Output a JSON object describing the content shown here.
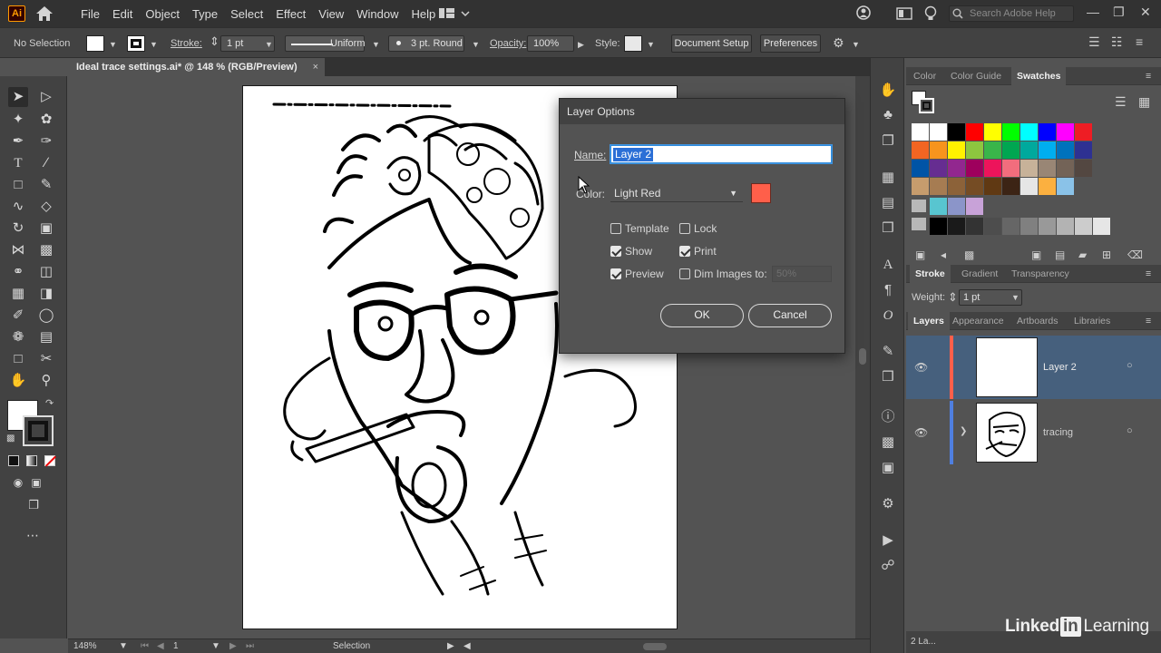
{
  "app": {
    "logo": "Ai"
  },
  "menu": [
    "File",
    "Edit",
    "Object",
    "Type",
    "Select",
    "Effect",
    "View",
    "Window",
    "Help"
  ],
  "search": {
    "placeholder": "Search Adobe Help"
  },
  "control_bar": {
    "selection": "No Selection",
    "stroke_label": "Stroke:",
    "stroke_weight": "1 pt",
    "profile": "Uniform",
    "brush": "3 pt. Round",
    "opacity_label": "Opacity:",
    "opacity": "100%",
    "style_label": "Style:",
    "document_setup": "Document Setup",
    "preferences": "Preferences"
  },
  "document_tab": {
    "title": "Ideal trace settings.ai* @ 148 % (RGB/Preview)",
    "close": "×"
  },
  "status_bar": {
    "zoom": "148%",
    "artboard": "1",
    "tool": "Selection"
  },
  "dialog": {
    "title": "Layer Options",
    "name_label": "Name:",
    "name_value": "Layer 2",
    "color_label": "Color:",
    "color_value": "Light Red",
    "color_hex": "#ff5f4a",
    "checkboxes": {
      "template": {
        "label": "Template",
        "checked": false
      },
      "lock": {
        "label": "Lock",
        "checked": false
      },
      "show": {
        "label": "Show",
        "checked": true
      },
      "print": {
        "label": "Print",
        "checked": true
      },
      "preview": {
        "label": "Preview",
        "checked": true
      },
      "dim": {
        "label": "Dim Images to:",
        "checked": false,
        "value": "50%"
      }
    },
    "ok": "OK",
    "cancel": "Cancel"
  },
  "swatches_panel": {
    "tabs": [
      "Color",
      "Color Guide",
      "Swatches"
    ],
    "active_tab": "Swatches",
    "row1": [
      "#ffffff",
      "#ffffff",
      "#000000",
      "#ff0000",
      "#ffff00",
      "#00ff00",
      "#00ffff",
      "#0000ff",
      "#ff00ff",
      "#ee1d24"
    ],
    "row2": [
      "#f26522",
      "#f7941d",
      "#fff200",
      "#8dc63f",
      "#39b54a",
      "#00a651",
      "#00a99d",
      "#00aeef",
      "#0072bc",
      "#2e3192"
    ],
    "row3": [
      "#0054a6",
      "#662d91",
      "#92278f",
      "#9e005d",
      "#ed145b",
      "#f26d7d",
      "#c7b299",
      "#998675",
      "#736357",
      "#534741"
    ],
    "row4": [
      "#c69c6d",
      "#a67c52",
      "#8c6239",
      "#754c24",
      "#603913",
      "#3c2415",
      "#e6e6e6",
      "#fbb040",
      "#8ac2e8"
    ],
    "row5": [
      "#58c5d0",
      "#8b95c9",
      "#c8a2d8"
    ],
    "row6": [
      "#000000",
      "#1a1a1a",
      "#333333",
      "#4d4d4d",
      "#666666",
      "#808080",
      "#999999",
      "#b3b3b3",
      "#cccccc",
      "#e6e6e6"
    ]
  },
  "stroke_panel": {
    "tabs": [
      "Stroke",
      "Gradient",
      "Transparency"
    ],
    "weight_label": "Weight:",
    "weight_value": "1 pt"
  },
  "layers_panel": {
    "tabs": [
      "Layers",
      "Appearance",
      "Artboards",
      "Libraries"
    ],
    "layers": [
      {
        "name": "Layer 2",
        "color": "#ff5f4a",
        "selected": true
      },
      {
        "name": "tracing",
        "color": "#4f7fe0",
        "selected": false
      }
    ],
    "count": "2 La..."
  },
  "watermark": {
    "brand1": "Linked",
    "brand2": "in",
    "brand3": "Learning"
  }
}
